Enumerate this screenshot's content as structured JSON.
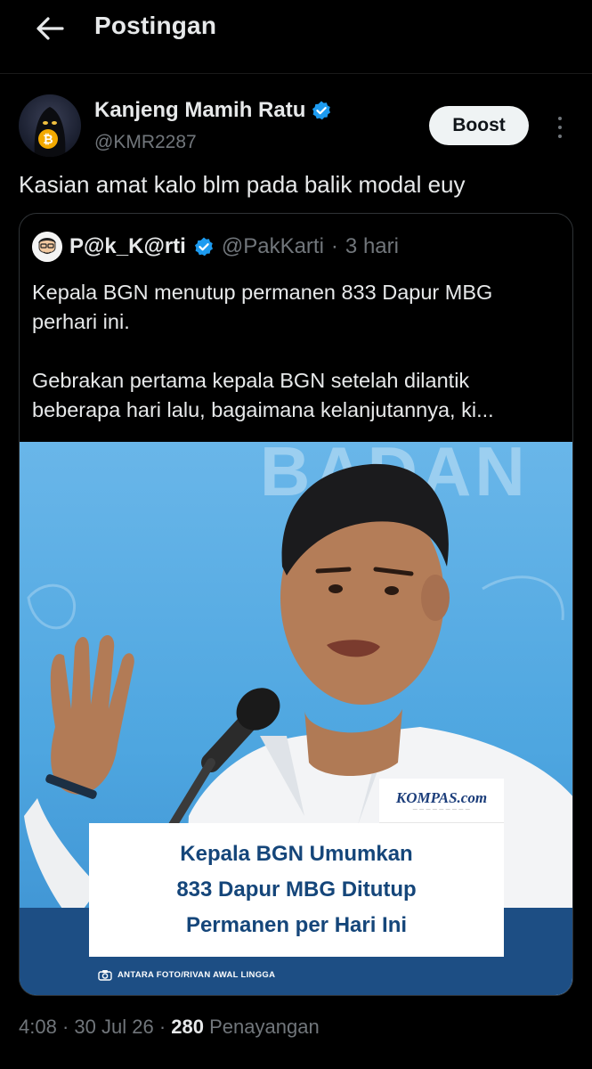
{
  "header": {
    "title": "Postingan"
  },
  "post": {
    "display_name": "Kanjeng Mamih Ratu",
    "handle": "@KMR2287",
    "text": "Kasian amat kalo blm pada balik modal euy",
    "boost_label": "Boost"
  },
  "quote": {
    "display_name": "P@k_K@rti",
    "handle": "@PakKarti",
    "separator": "·",
    "time": "3 hari",
    "paragraphs": [
      "Kepala BGN menutup permanen 833 Dapur MBG perhari ini.",
      "Gebrakan pertama kepala BGN setelah dilantik beberapa hari lalu, bagaimana kelanjutannya, ki..."
    ],
    "media": {
      "background_text": "BADAN",
      "brand": "KOMPAS.com",
      "caption_lines": [
        "Kepala BGN Umumkan",
        "833 Dapur MBG Ditutup",
        "Permanen per Hari Ini"
      ],
      "credit": "ANTARA FOTO/RIVAN AWAL LINGGA"
    }
  },
  "footer": {
    "time": "4:08",
    "dot1": "·",
    "date": "30 Jul 26",
    "dot2": "·",
    "views_count": "280",
    "views_label": "Penayangan"
  },
  "colors": {
    "verified": "#1d9bf0",
    "background": "#000000",
    "muted": "#71767b"
  },
  "icons": {
    "back": "arrow-left-icon",
    "verified": "verified-badge-icon",
    "more": "more-vertical-icon",
    "camera": "camera-icon"
  }
}
